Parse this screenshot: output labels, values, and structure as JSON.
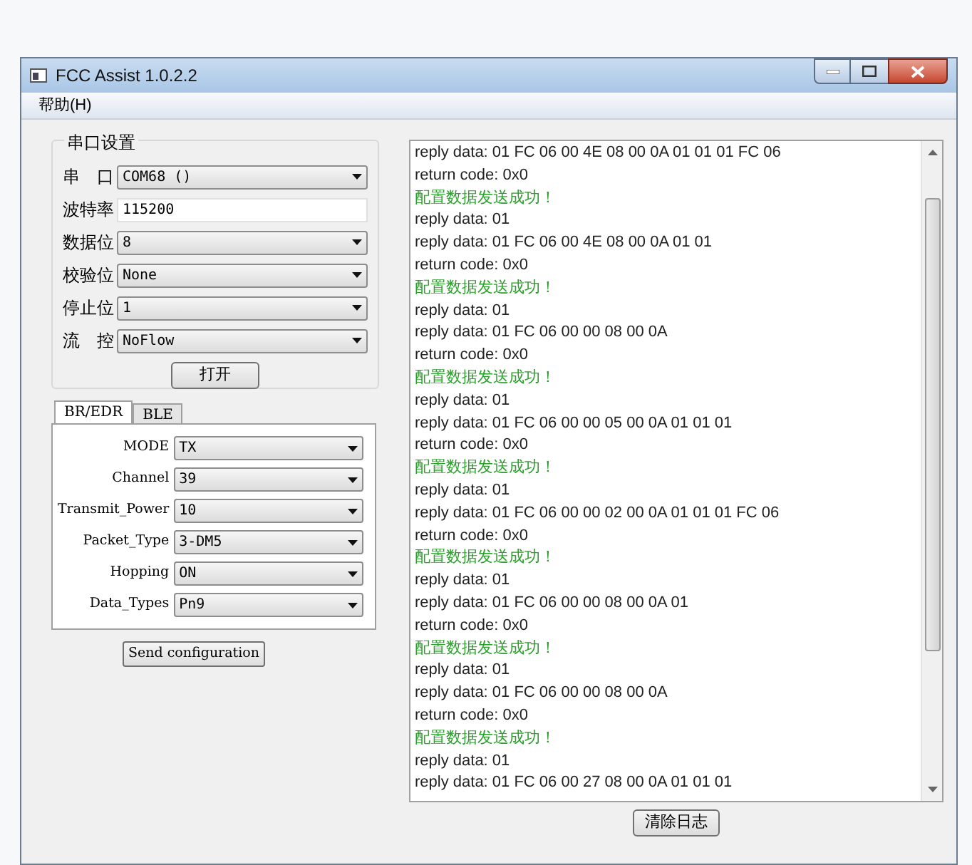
{
  "window": {
    "title": "FCC Assist 1.0.2.2"
  },
  "menu": [
    "帮助(H)"
  ],
  "serial_group": {
    "title": "串口设置",
    "fields": [
      {
        "label": "串　口",
        "value": "COM68 ()",
        "kind": "combo"
      },
      {
        "label": "波特率",
        "value": "115200",
        "kind": "input"
      },
      {
        "label": "数据位",
        "value": "8",
        "kind": "combo"
      },
      {
        "label": "校验位",
        "value": "None",
        "kind": "combo"
      },
      {
        "label": "停止位",
        "value": "1",
        "kind": "combo"
      },
      {
        "label": "流　控",
        "value": "NoFlow",
        "kind": "combo"
      }
    ],
    "open_button": "打开"
  },
  "tabs": [
    {
      "label": "BR/EDR",
      "selected": true
    },
    {
      "label": "BLE",
      "selected": false
    }
  ],
  "config_fields": [
    {
      "label": "MODE",
      "value": "TX"
    },
    {
      "label": "Channel",
      "value": "39"
    },
    {
      "label": "Transmit_Power",
      "value": "10"
    },
    {
      "label": "Packet_Type",
      "value": "3-DM5"
    },
    {
      "label": "Hopping",
      "value": "ON"
    },
    {
      "label": "Data_Types",
      "value": "Pn9"
    }
  ],
  "send_button": "Send configuration",
  "log": [
    {
      "text": "reply data: 01 FC 06 00 4E 08 00 0A 01 01 01 FC 06",
      "kind": "data"
    },
    {
      "text": "return code: 0x0",
      "kind": "data"
    },
    {
      "text": "配置数据发送成功！",
      "kind": "success"
    },
    {
      "text": "reply data: 01",
      "kind": "data"
    },
    {
      "text": "reply data: 01 FC 06 00 4E 08 00 0A 01 01",
      "kind": "data"
    },
    {
      "text": "return code: 0x0",
      "kind": "data"
    },
    {
      "text": "配置数据发送成功！",
      "kind": "success"
    },
    {
      "text": "reply data: 01",
      "kind": "data"
    },
    {
      "text": "reply data: 01 FC 06 00 00 08 00 0A",
      "kind": "data"
    },
    {
      "text": "return code: 0x0",
      "kind": "data"
    },
    {
      "text": "配置数据发送成功！",
      "kind": "success"
    },
    {
      "text": "reply data: 01",
      "kind": "data"
    },
    {
      "text": "reply data: 01 FC 06 00 00 05 00 0A 01 01 01",
      "kind": "data"
    },
    {
      "text": "return code: 0x0",
      "kind": "data"
    },
    {
      "text": "配置数据发送成功！",
      "kind": "success"
    },
    {
      "text": "reply data: 01",
      "kind": "data"
    },
    {
      "text": "reply data: 01 FC 06 00 00 02 00 0A 01 01 01 FC 06",
      "kind": "data"
    },
    {
      "text": "return code: 0x0",
      "kind": "data"
    },
    {
      "text": "配置数据发送成功！",
      "kind": "success"
    },
    {
      "text": "reply data: 01",
      "kind": "data"
    },
    {
      "text": "reply data: 01 FC 06 00 00 08 00 0A 01",
      "kind": "data"
    },
    {
      "text": "return code: 0x0",
      "kind": "data"
    },
    {
      "text": "配置数据发送成功！",
      "kind": "success"
    },
    {
      "text": "reply data: 01",
      "kind": "data"
    },
    {
      "text": "reply data: 01 FC 06 00 00 08 00 0A",
      "kind": "data"
    },
    {
      "text": "return code: 0x0",
      "kind": "data"
    },
    {
      "text": "配置数据发送成功！",
      "kind": "success"
    },
    {
      "text": "reply data: 01",
      "kind": "data"
    },
    {
      "text": "reply data: 01 FC 06 00 27 08 00 0A 01 01 01",
      "kind": "data"
    }
  ],
  "clear_button": "清除日志"
}
